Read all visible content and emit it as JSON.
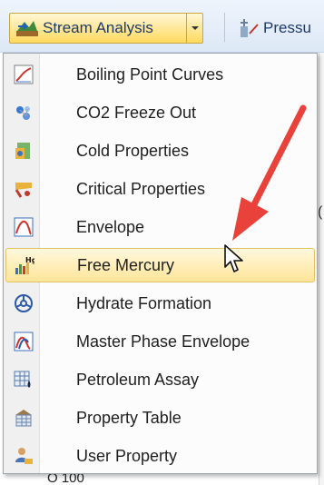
{
  "toolbar": {
    "stream_analysis_label": "Stream Analysis",
    "pressure_label": "Pressu"
  },
  "menu": {
    "items": [
      {
        "label": "Boiling Point Curves",
        "icon": "boiling-point-curves-icon"
      },
      {
        "label": "CO2 Freeze Out",
        "icon": "co2-freeze-out-icon"
      },
      {
        "label": "Cold Properties",
        "icon": "cold-properties-icon"
      },
      {
        "label": "Critical Properties",
        "icon": "critical-properties-icon"
      },
      {
        "label": "Envelope",
        "icon": "envelope-icon"
      },
      {
        "label": "Free Mercury",
        "icon": "free-mercury-icon",
        "highlighted": true
      },
      {
        "label": "Hydrate Formation",
        "icon": "hydrate-formation-icon"
      },
      {
        "label": "Master Phase Envelope",
        "icon": "master-phase-envelope-icon"
      },
      {
        "label": "Petroleum Assay",
        "icon": "petroleum-assay-icon"
      },
      {
        "label": "Property Table",
        "icon": "property-table-icon"
      },
      {
        "label": "User Property",
        "icon": "user-property-icon"
      }
    ],
    "highlight_color": "#ffe59a"
  },
  "background": {
    "edge_char": "(",
    "bottom_label": "O 100"
  },
  "annotation": {
    "arrow_color": "#e8423a"
  }
}
